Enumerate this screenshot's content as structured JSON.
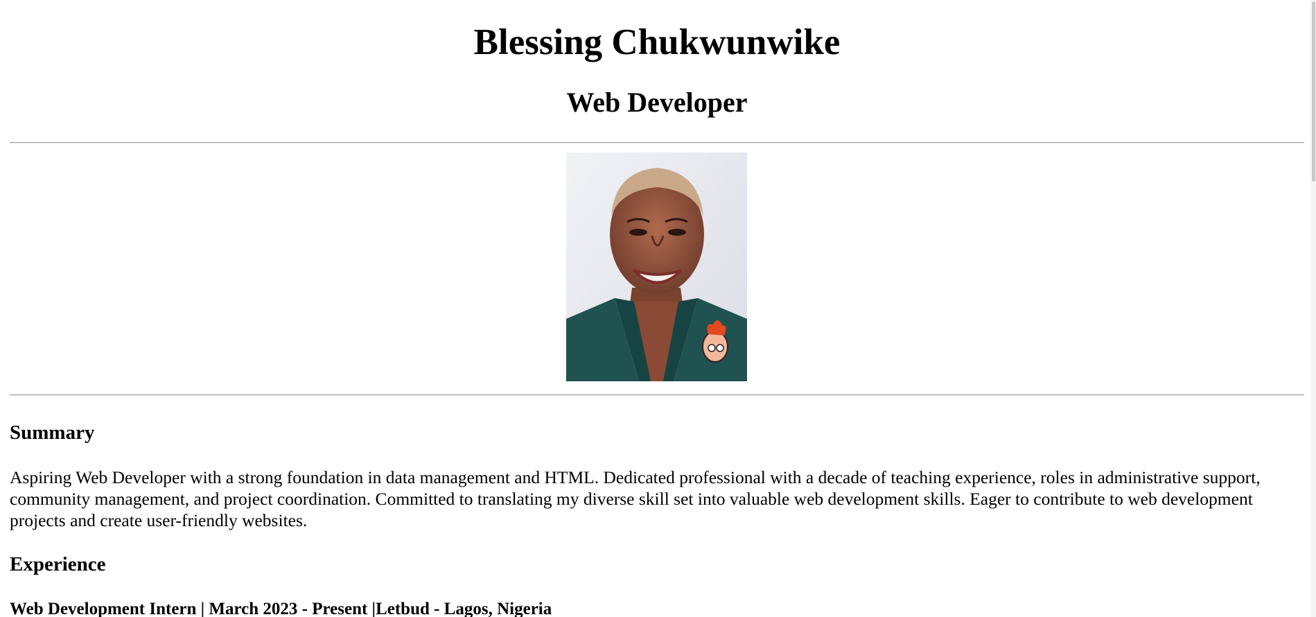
{
  "header": {
    "name": "Blessing Chukwunwike",
    "role": "Web Developer"
  },
  "photo": {
    "alt": "Blessing Chukwunwike"
  },
  "summary": {
    "title": "Summary",
    "text": "Aspiring Web Developer with a strong foundation in data management and HTML. Dedicated professional with a decade of teaching experience, roles in administrative support, community management, and project coordination. Committed to translating my diverse skill set into valuable web development skills. Eager to contribute to web development projects and create user-friendly websites."
  },
  "experience": {
    "title": "Experience",
    "jobs": [
      {
        "heading": "Web Development Intern | March 2023 - Present |Letbud - Lagos, Nigeria"
      }
    ]
  }
}
